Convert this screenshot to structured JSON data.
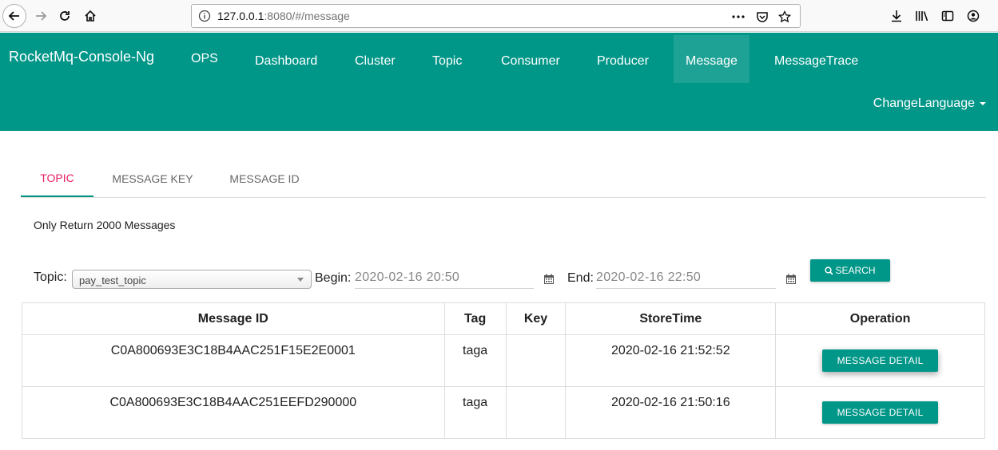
{
  "browser": {
    "url_host": "127.0.0.1",
    "url_rest": ":8080/#/message"
  },
  "navbar": {
    "brand": "RocketMq-Console-Ng",
    "items": [
      {
        "label": "OPS"
      },
      {
        "label": "Dashboard"
      },
      {
        "label": "Cluster"
      },
      {
        "label": "Topic"
      },
      {
        "label": "Consumer"
      },
      {
        "label": "Producer"
      },
      {
        "label": "Message",
        "active": true
      },
      {
        "label": "MessageTrace"
      }
    ],
    "change_language": "ChangeLanguage",
    "color": "#009688"
  },
  "tabs": [
    {
      "label": "TOPIC",
      "active": true
    },
    {
      "label": "MESSAGE KEY"
    },
    {
      "label": "MESSAGE ID"
    }
  ],
  "notice": "Only Return 2000 Messages",
  "query": {
    "topic_label": "Topic:",
    "topic_value": "pay_test_topic",
    "begin_label": "Begin:",
    "begin_value": "2020-02-16 20:50",
    "end_label": "End:",
    "end_value": "2020-02-16 22:50",
    "search_label": "SEARCH"
  },
  "table": {
    "headers": [
      "Message ID",
      "Tag",
      "Key",
      "StoreTime",
      "Operation"
    ],
    "rows": [
      {
        "message_id": "C0A800693E3C18B4AAC251F15E2E0001",
        "tag": "taga",
        "key": "",
        "store_time": "2020-02-16 21:52:52",
        "operation": "MESSAGE DETAIL"
      },
      {
        "message_id": "C0A800693E3C18B4AAC251EEFD290000",
        "tag": "taga",
        "key": "",
        "store_time": "2020-02-16 21:50:16",
        "operation": "MESSAGE DETAIL"
      }
    ]
  }
}
